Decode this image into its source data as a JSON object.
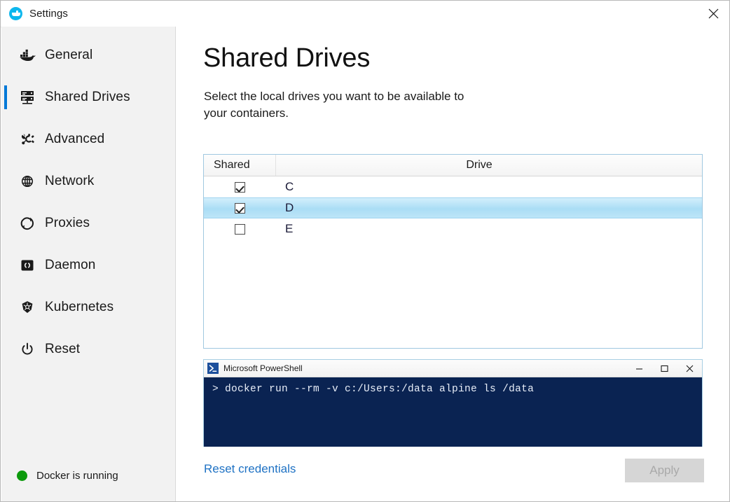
{
  "window": {
    "title": "Settings",
    "logo_icon": "docker-whale-icon",
    "close_icon": "close-icon"
  },
  "sidebar": {
    "items": [
      {
        "label": "General",
        "icon": "docker-whale-icon",
        "active": false
      },
      {
        "label": "Shared Drives",
        "icon": "server-drives-icon",
        "active": true
      },
      {
        "label": "Advanced",
        "icon": "gear-settings-icon",
        "active": false
      },
      {
        "label": "Network",
        "icon": "globe-network-icon",
        "active": false
      },
      {
        "label": "Proxies",
        "icon": "proxy-arrows-icon",
        "active": false
      },
      {
        "label": "Daemon",
        "icon": "code-brackets-icon",
        "active": false
      },
      {
        "label": "Kubernetes",
        "icon": "kubernetes-helm-icon",
        "active": false
      },
      {
        "label": "Reset",
        "icon": "power-icon",
        "active": false
      }
    ],
    "status": {
      "text": "Docker is running",
      "color": "#0c9a0c",
      "icon": "status-dot-icon"
    }
  },
  "main": {
    "title": "Shared Drives",
    "subtitle": "Select the local drives you want to be available to your containers.",
    "table": {
      "columns": [
        "Shared",
        "Drive"
      ],
      "rows": [
        {
          "shared": true,
          "drive": "C",
          "selected": false
        },
        {
          "shared": true,
          "drive": "D",
          "selected": true
        },
        {
          "shared": false,
          "drive": "E",
          "selected": false
        }
      ]
    },
    "terminal": {
      "title": "Microsoft PowerShell",
      "icon": "powershell-icon",
      "minimize_icon": "minimize-icon",
      "maximize_icon": "maximize-icon",
      "close_icon": "close-icon",
      "lines": [
        "> docker run --rm -v c:/Users:/data alpine ls /data"
      ],
      "background": "#0a2352"
    },
    "footer": {
      "reset_link": "Reset credentials",
      "apply_label": "Apply",
      "apply_enabled": false
    }
  },
  "colors": {
    "accent": "#0078d7",
    "link": "#1f72c4",
    "sidebar_bg": "#f2f2f2",
    "selection": "#aaddf5",
    "docker_blue": "#0db7ed"
  }
}
